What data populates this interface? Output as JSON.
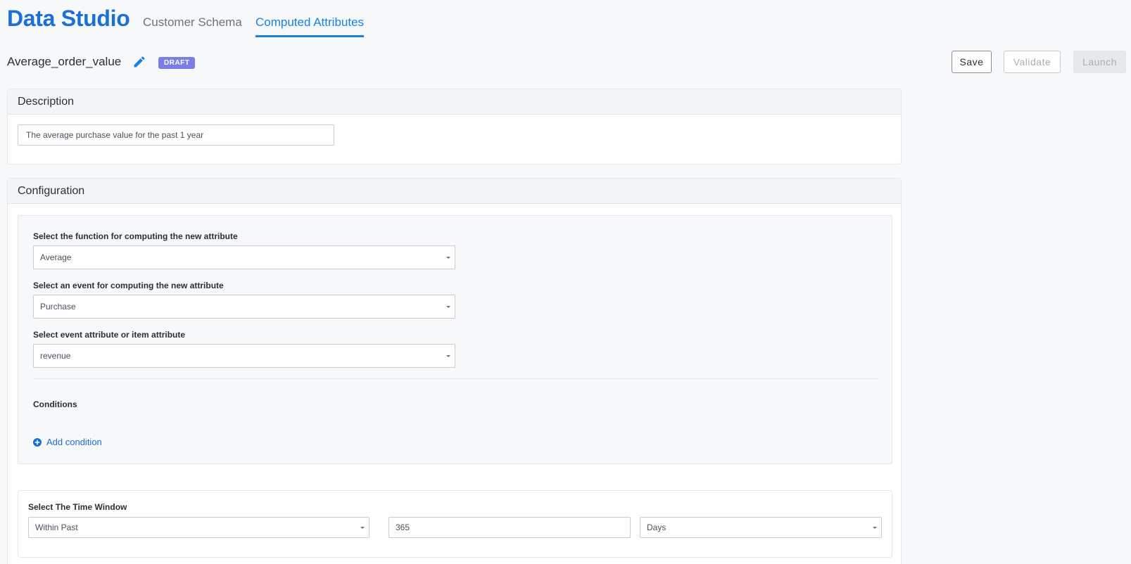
{
  "header": {
    "app_title": "Data Studio",
    "tabs": [
      {
        "label": "Customer Schema",
        "active": false
      },
      {
        "label": "Computed Attributes",
        "active": true
      }
    ]
  },
  "attribute": {
    "name": "Average_order_value",
    "status": "DRAFT"
  },
  "actions": {
    "save": "Save",
    "validate": "Validate",
    "launch": "Launch"
  },
  "description": {
    "heading": "Description",
    "value": "The average purchase value for the past 1 year"
  },
  "configuration": {
    "heading": "Configuration",
    "function_label": "Select the function for computing the new attribute",
    "function_value": "Average",
    "event_label": "Select an event for computing the new attribute",
    "event_value": "Purchase",
    "attribute_label": "Select event attribute or item attribute",
    "attribute_value": "revenue",
    "conditions_label": "Conditions",
    "add_condition": "Add condition"
  },
  "time_window": {
    "label": "Select The Time Window",
    "range_value": "Within Past",
    "amount_value": "365",
    "unit_value": "Days"
  },
  "colors": {
    "brand": "#1a6fd8",
    "draft_badge": "#7b7ee8"
  }
}
